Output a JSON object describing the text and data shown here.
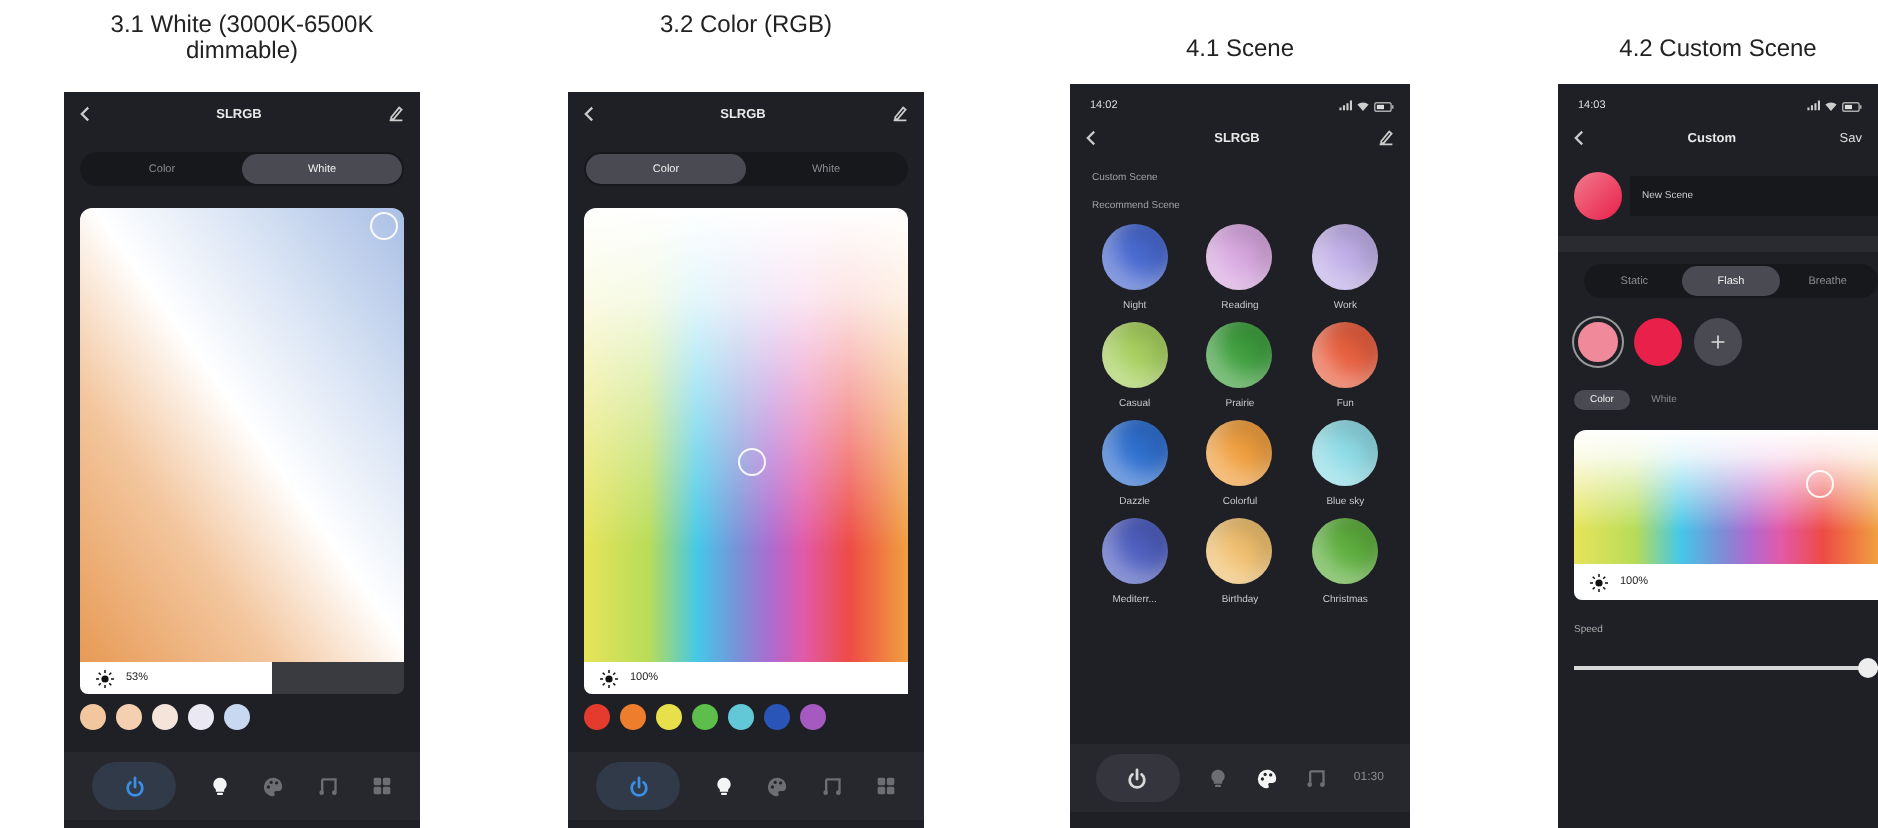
{
  "panels": [
    {
      "kind": "light",
      "caption": "3.1 White (3000K-6500K dimmable)",
      "title": "SLRGB",
      "tabs": [
        {
          "label": "Color",
          "selected": false
        },
        {
          "label": "White",
          "selected": true
        }
      ],
      "picker": {
        "kind": "white"
      },
      "brightness": {
        "reading": "53%",
        "level": 0.59
      },
      "swatches": [
        {
          "color": "#f2c79e"
        },
        {
          "color": "#f5d0b0"
        },
        {
          "color": "#f5e4da"
        },
        {
          "color": "#eae8f2"
        },
        {
          "color": "#c8d8f0"
        }
      ],
      "nav": [
        {
          "kind": "power",
          "on": true
        },
        {
          "kind": "bulb",
          "selected": true
        },
        {
          "kind": "palette",
          "selected": false
        },
        {
          "kind": "music",
          "selected": false
        },
        {
          "kind": "grid",
          "selected": false
        }
      ]
    },
    {
      "kind": "light",
      "caption": "3.2 Color (RGB)",
      "title": "SLRGB",
      "tabs": [
        {
          "label": "Color",
          "selected": true
        },
        {
          "label": "White",
          "selected": false
        }
      ],
      "picker": {
        "kind": "color"
      },
      "brightness": {
        "reading": "100%",
        "level": 1
      },
      "swatches": [
        {
          "color": "#e53b2e"
        },
        {
          "color": "#ee7d2e"
        },
        {
          "color": "#e8e04a"
        },
        {
          "color": "#5dbe4c"
        },
        {
          "color": "#62c8d8"
        },
        {
          "color": "#2a55b8"
        },
        {
          "color": "#a45ac0"
        }
      ],
      "nav": [
        {
          "kind": "power",
          "on": true
        },
        {
          "kind": "bulb",
          "selected": true
        },
        {
          "kind": "palette",
          "selected": false
        },
        {
          "kind": "music",
          "selected": false
        },
        {
          "kind": "grid",
          "selected": false
        }
      ]
    },
    {
      "kind": "scene",
      "caption": "4.1 Scene",
      "status_time": "14:02",
      "title": "SLRGB",
      "custom_label": "Custom Scene",
      "recommend_label": "Recommend Scene",
      "scenes": [
        {
          "name": "Night",
          "color": "#4a6ad0"
        },
        {
          "name": "Reading",
          "color": "#d8a8e0"
        },
        {
          "name": "Work",
          "color": "#c0b0e8"
        },
        {
          "name": "Casual",
          "color": "#a8d060"
        },
        {
          "name": "Prairie",
          "color": "#40a040"
        },
        {
          "name": "Fun",
          "color": "#e86040"
        },
        {
          "name": "Dazzle",
          "color": "#3070d0"
        },
        {
          "name": "Colorful",
          "color": "#f0a040"
        },
        {
          "name": "Blue sky",
          "color": "#90dce6"
        },
        {
          "name": "Mediterr...",
          "color": "#5060c0"
        },
        {
          "name": "Birthday",
          "color": "#f0c070"
        },
        {
          "name": "Christmas",
          "color": "#60b040"
        }
      ],
      "nav": [
        {
          "kind": "power",
          "on": false
        },
        {
          "kind": "bulb",
          "selected": false
        },
        {
          "kind": "palette",
          "selected": true
        },
        {
          "kind": "music",
          "selected": false
        },
        {
          "kind": "timer",
          "label": "01:30",
          "selected": false
        }
      ]
    },
    {
      "kind": "custom",
      "caption": "4.2 Custom Scene",
      "status_time": "14:03",
      "title": "Custom",
      "action": "Sav",
      "name_value": "New Scene",
      "modes": [
        {
          "label": "Static",
          "selected": false
        },
        {
          "label": "Flash",
          "selected": true
        },
        {
          "label": "Breathe",
          "selected": false
        }
      ],
      "slots": [
        {
          "color": "#f08a9a",
          "selected": true
        },
        {
          "color": "#e8204a",
          "selected": false
        }
      ],
      "color_tabs": [
        {
          "label": "Color",
          "selected": true
        },
        {
          "label": "White",
          "selected": false
        }
      ],
      "picker": {
        "kind": "color"
      },
      "brightness": {
        "reading": "100%",
        "level": 1
      },
      "speed_label": "Speed",
      "speed": {
        "level": 1
      }
    }
  ]
}
